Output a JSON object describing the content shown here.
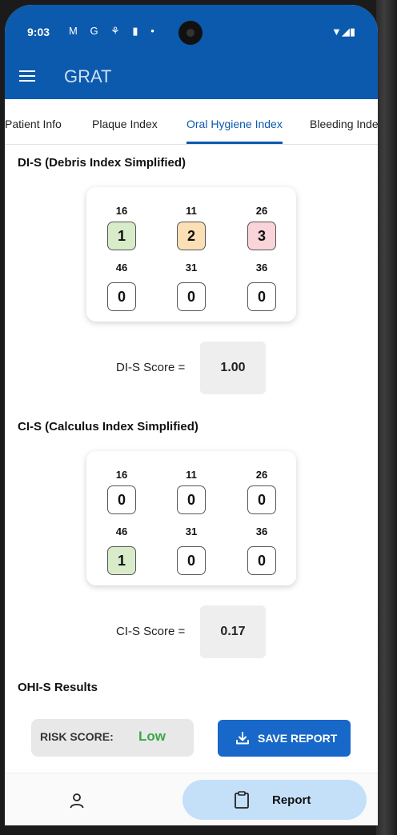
{
  "status_bar": {
    "time": "9:03",
    "left_icons": "M G ⚘ ▮ •",
    "right_icons": "▼◢▮"
  },
  "app_bar": {
    "title": "GRAT"
  },
  "tabs": [
    {
      "label": "Patient Info",
      "active": false
    },
    {
      "label": "Plaque Index",
      "active": false
    },
    {
      "label": "Oral Hygiene Index",
      "active": true
    },
    {
      "label": "Bleeding Inde",
      "active": false
    }
  ],
  "colors": {
    "primary": "#0b5aad",
    "score_1": "#d9ecc9",
    "score_2": "#fbe0b5",
    "score_3": "#f9d4d8",
    "risk_low": "#3aa64a",
    "button": "#1768c9",
    "nav_active": "#c4e0f9"
  },
  "dis": {
    "title": "DI-S (Debris Index Simplified)",
    "teeth": [
      {
        "tooth": "16",
        "score": "1"
      },
      {
        "tooth": "11",
        "score": "2"
      },
      {
        "tooth": "26",
        "score": "3"
      },
      {
        "tooth": "46",
        "score": "0"
      },
      {
        "tooth": "31",
        "score": "0"
      },
      {
        "tooth": "36",
        "score": "0"
      }
    ],
    "score_label": "DI-S Score =",
    "score_value": "1.00"
  },
  "cis": {
    "title": "CI-S (Calculus Index Simplified)",
    "teeth": [
      {
        "tooth": "16",
        "score": "0"
      },
      {
        "tooth": "11",
        "score": "0"
      },
      {
        "tooth": "26",
        "score": "0"
      },
      {
        "tooth": "46",
        "score": "1"
      },
      {
        "tooth": "31",
        "score": "0"
      },
      {
        "tooth": "36",
        "score": "0"
      }
    ],
    "score_label": "CI-S Score =",
    "score_value": "0.17"
  },
  "results": {
    "title": "OHI-S Results",
    "risk_label": "RISK SCORE:",
    "risk_value": "Low",
    "save_label": "SAVE REPORT"
  },
  "bottom_nav": {
    "profile_icon": "person-icon",
    "report_icon": "clipboard-icon",
    "report_label": "Report"
  }
}
